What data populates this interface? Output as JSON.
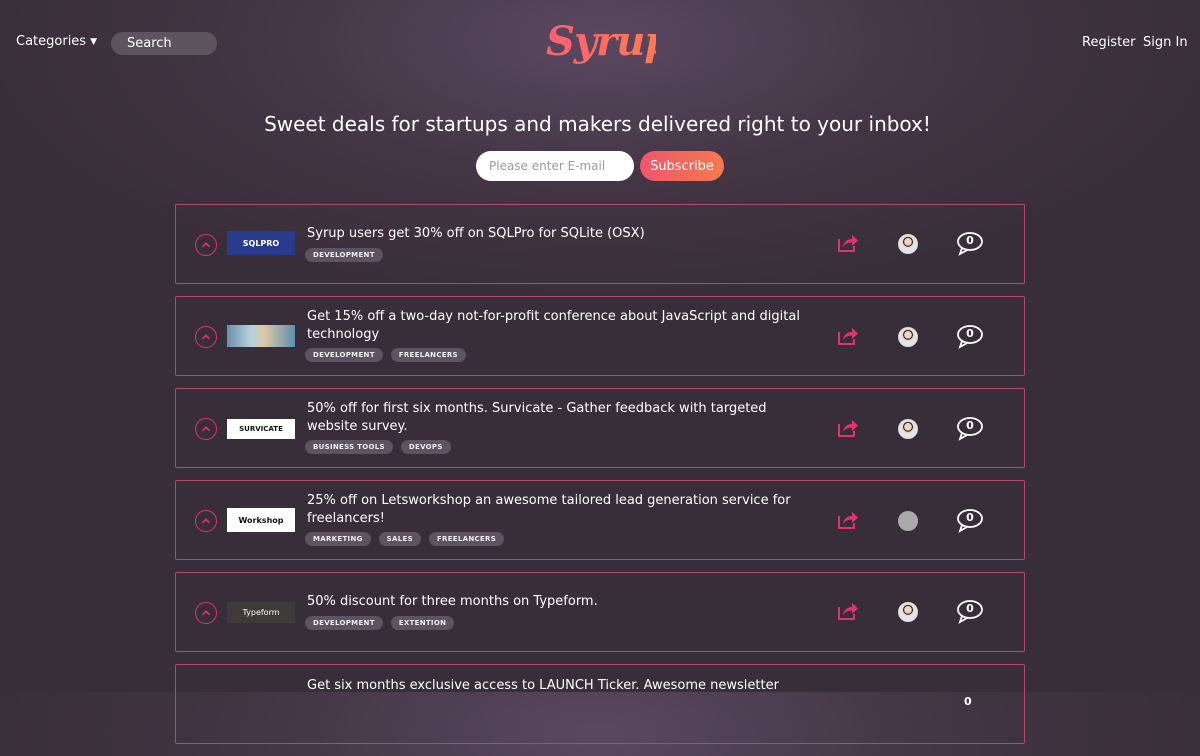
{
  "nav": {
    "categories_label": "Categories",
    "search_placeholder": "Search",
    "logo_text": "Syrup",
    "register_label": "Register",
    "signin_label": "Sign In"
  },
  "hero": {
    "tagline": "Sweet deals for startups and makers delivered right to your inbox!",
    "email_placeholder": "Please enter E-mail",
    "subscribe_label": "Subscribe"
  },
  "colors": {
    "accent": "#e2336d",
    "subscribe_gradient": [
      "#f0566c",
      "#f67a4c"
    ],
    "card_border": "#b44a6a",
    "tag_bg": "#5e5363"
  },
  "deals": [
    {
      "title": "Syrup users get 30% off on SQLPro for SQLite (OSX)",
      "thumb_text": "SQLPRO",
      "tags": [
        "DEVELOPMENT"
      ],
      "comments": "0"
    },
    {
      "title": "Get 15% off a two-day not-for-profit conference about JavaScript and digital technology",
      "thumb_text": "",
      "tags": [
        "DEVELOPMENT",
        "FREELANCERS"
      ],
      "comments": "0"
    },
    {
      "title": "50% off for first six months. Survicate - Gather feedback with targeted website survey.",
      "thumb_text": "SURVICATE",
      "tags": [
        "BUSINESS TOOLS",
        "DEVOPS"
      ],
      "comments": "0"
    },
    {
      "title": "25% off on Letsworkshop an awesome tailored lead generation service for freelancers!",
      "thumb_text": "Workshop",
      "tags": [
        "MARKETING",
        "SALES",
        "FREELANCERS"
      ],
      "comments": "0"
    },
    {
      "title": "50% discount for three months on Typeform.",
      "thumb_text": "Typeform",
      "tags": [
        "DEVELOPMENT",
        "EXTENTION"
      ],
      "comments": "0"
    },
    {
      "title": "Get six months exclusive access to LAUNCH Ticker. Awesome newsletter",
      "thumb_text": "",
      "tags": [],
      "comments": "0"
    }
  ]
}
